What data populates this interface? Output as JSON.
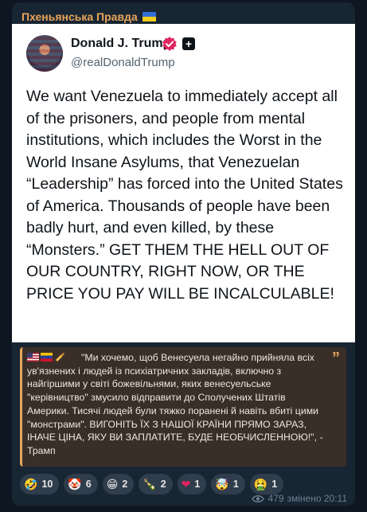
{
  "channel": {
    "name": "Пхеньянська Правда"
  },
  "tweet": {
    "author_name": "Donald J. Trump",
    "handle": "@realDonaldTrump",
    "text": "We want Venezuela to immediately accept all of the prisoners, and people from mental institutions, which includes the Worst in the World Insane Asylums, that Venezuelan “Leadership” has forced into the United States of America. Thousands of people have been badly hurt, and even killed, by these “Monsters.” GET THEM THE HELL OUT OF OUR COUNTRY, RIGHT NOW, OR THE PRICE YOU PAY WILL BE INCALCULABLE!"
  },
  "quote": {
    "text": "\"Ми хочемо, щоб Венесуела негайно прийняла всіх ув'язнених і людей із психіатричних закладів, включно з найгіршими у світі божевільнями, яких венесуельське \"керівництво\" змусило відправити до Сполучених Штатів Америки. Тисячі людей були тяжко поранені й навіть вбиті цими \"монстрами\". ВИГОНІТЬ ЇХ З НАШОЇ КРАЇНИ ПРЯМО ЗАРАЗ, ІНАЧЕ ЦІНА, ЯКУ ВИ ЗАПЛАТИТЕ, БУДЕ НЕОБЧИСЛЕННОЮ!\", - Трамп",
    "icon": "quote-mark-icon"
  },
  "reactions": [
    {
      "emoji": "🤣",
      "count": "10",
      "icon": "rofl-icon"
    },
    {
      "emoji": "🤡",
      "count": "6",
      "icon": "clown-icon"
    },
    {
      "emoji": "😁",
      "count": "2",
      "icon": "grin-icon"
    },
    {
      "emoji": "🍾",
      "count": "2",
      "icon": "champagne-icon"
    },
    {
      "emoji": "❤",
      "count": "1",
      "icon": "heart-icon"
    },
    {
      "emoji": "🤯",
      "count": "1",
      "icon": "mind-blown-icon"
    },
    {
      "emoji": "🤮",
      "count": "1",
      "icon": "vomit-icon"
    }
  ],
  "meta": {
    "views": "479",
    "status": "змінено 20:11"
  },
  "colors": {
    "background": "#0e1621",
    "bubble": "#182533",
    "channel_accent": "#e8a55b",
    "quote_bg": "#3a2f28",
    "verified": "#e0245e"
  }
}
